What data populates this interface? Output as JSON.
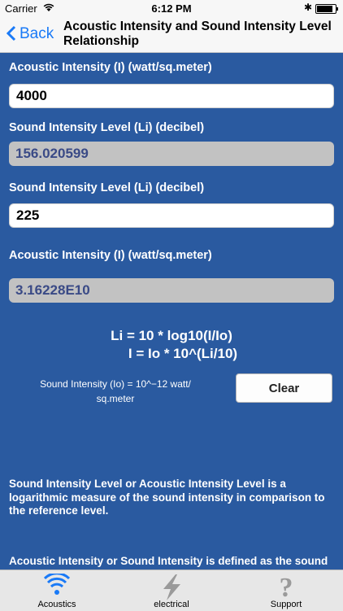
{
  "status": {
    "carrier": "Carrier",
    "time": "6:12 PM",
    "bluetooth": "✱"
  },
  "nav": {
    "back_label": "Back",
    "title": "Acoustic Intensity and Sound Intensity Level Relationship"
  },
  "form": {
    "label1": "Acoustic Intensity (I) (watt/sq.meter)",
    "input1_value": "4000",
    "label2": "Sound Intensity Level (Li) (decibel)",
    "output1_value": "156.020599",
    "label3": "Sound Intensity Level (Li) (decibel)",
    "input2_value": "225",
    "label4": "Acoustic Intensity (I) (watt/sq.meter)",
    "output2_value": "3.16228E10"
  },
  "formula": {
    "line1": "Li = 10 * log10(I/Io)",
    "line2": "I = Io * 10^(Li/10)"
  },
  "reference": {
    "line1": "Sound Intensity (Io) = 10^−12 watt/",
    "line2": "sq.meter"
  },
  "clear_label": "Clear",
  "description": {
    "para1": "Sound Intensity Level or Acoustic Intensity Level is a logarithmic measure of the sound intensity in comparison to the reference level.",
    "para2": "Acoustic Intensity or Sound Intensity is defined as the sound"
  },
  "tabs": [
    {
      "label": "Acoustics",
      "icon": "wifi-icon"
    },
    {
      "label": "electrical",
      "icon": "lightning-icon"
    },
    {
      "label": "Support",
      "icon": "question-icon"
    }
  ],
  "colors": {
    "background": "#2a5aa0",
    "accent": "#1a7af7",
    "readonly_text": "#3a4a86",
    "active_tab": "#1a7af7",
    "inactive_tab": "#9a9a9a"
  }
}
